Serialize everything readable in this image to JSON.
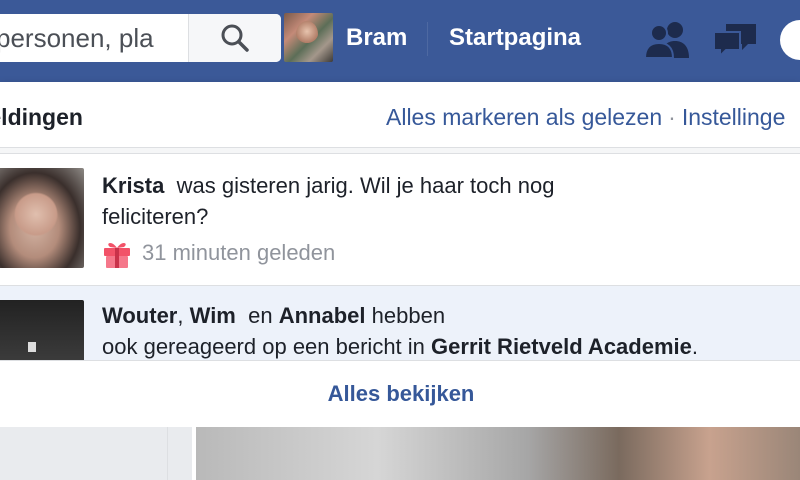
{
  "topbar": {
    "search_placeholder": "personen, pla",
    "user_name": "Bram",
    "home_label": "Startpagina"
  },
  "notifications_panel": {
    "title": "leldingen",
    "mark_all_read": "Alles markeren als gelezen",
    "separator": "·",
    "settings": "Instellinge",
    "items": [
      {
        "actor": "Krista",
        "text_1": "was gisteren jarig. Wil je haar toch nog",
        "text_2": "feliciteren?",
        "time": "31 minuten geleden",
        "icon": "gift-icon"
      },
      {
        "actor_1": "Wouter",
        "sep_1": ",",
        "actor_2": "Wim",
        "and_word": "en",
        "actor_3": "Annabel",
        "text_1": "hebben",
        "text_2": "ook gereageerd op een bericht in",
        "group": "Gerrit Rietveld Academie",
        "end": "."
      }
    ],
    "see_all": "Alles bekijken"
  },
  "colors": {
    "topbar": "#3b5998",
    "link": "#365899",
    "unread_bg": "#edf2fa",
    "gift": "#f25268"
  }
}
